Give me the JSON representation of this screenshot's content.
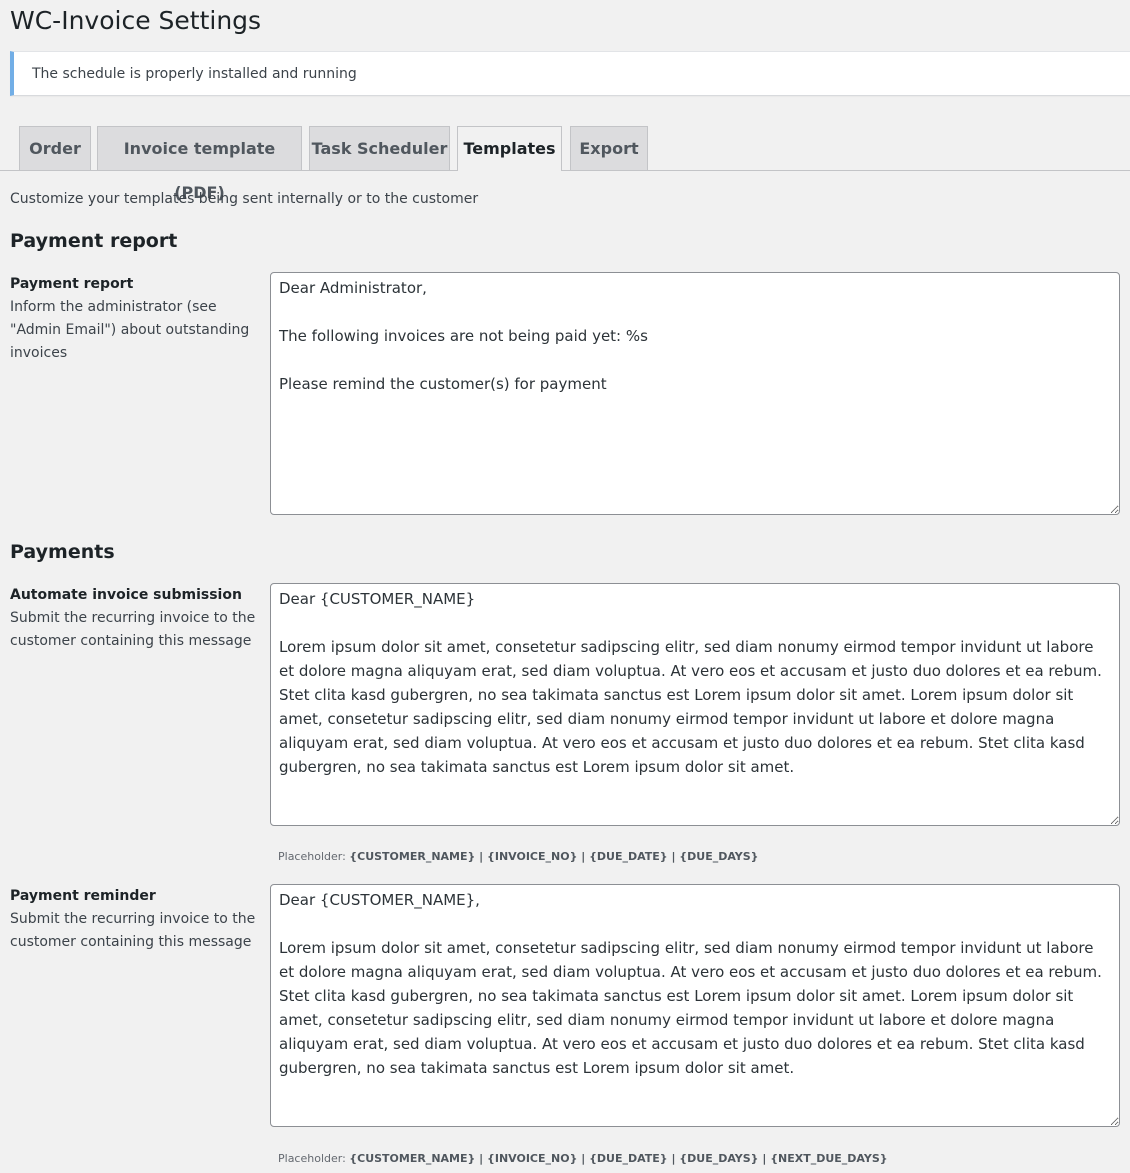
{
  "page": {
    "title": "WC-Invoice Settings"
  },
  "notice": {
    "text": "The schedule is properly installed and running"
  },
  "tabs": [
    {
      "label": "Order",
      "active": false
    },
    {
      "label": "Invoice template (PDF)",
      "active": false
    },
    {
      "label": "Task Scheduler",
      "active": false
    },
    {
      "label": "Templates",
      "active": true
    },
    {
      "label": "Export",
      "active": false
    }
  ],
  "intro": "Customize your templates being sent internally or to the customer",
  "sections": {
    "payment_report": {
      "title": "Payment report",
      "field": {
        "label": "Payment report",
        "description": "Inform the administrator (see \"Admin Email\") about outstanding invoices",
        "value": "Dear Administrator,\n\nThe following invoices are not being paid yet: %s\n\nPlease remind the customer(s) for payment"
      }
    },
    "payments": {
      "title": "Payments",
      "automate": {
        "label": "Automate invoice submission",
        "description": "Submit the recurring invoice to the customer containing this message",
        "value": "Dear {CUSTOMER_NAME}\n\nLorem ipsum dolor sit amet, consetetur sadipscing elitr, sed diam nonumy eirmod tempor invidunt ut labore et dolore magna aliquyam erat, sed diam voluptua. At vero eos et accusam et justo duo dolores et ea rebum. Stet clita kasd gubergren, no sea takimata sanctus est Lorem ipsum dolor sit amet. Lorem ipsum dolor sit amet, consetetur sadipscing elitr, sed diam nonumy eirmod tempor invidunt ut labore et dolore magna aliquyam erat, sed diam voluptua. At vero eos et accusam et justo duo dolores et ea rebum. Stet clita kasd gubergren, no sea takimata sanctus est Lorem ipsum dolor sit amet.",
        "placeholder_label": "Placeholder:",
        "placeholder_codes": "{CUSTOMER_NAME} | {INVOICE_NO} | {DUE_DATE} | {DUE_DAYS}"
      },
      "reminder": {
        "label": "Payment reminder",
        "description": "Submit the recurring invoice to the customer containing this message",
        "value": "Dear {CUSTOMER_NAME},\n\nLorem ipsum dolor sit amet, consetetur sadipscing elitr, sed diam nonumy eirmod tempor invidunt ut labore et dolore magna aliquyam erat, sed diam voluptua. At vero eos et accusam et justo duo dolores et ea rebum. Stet clita kasd gubergren, no sea takimata sanctus est Lorem ipsum dolor sit amet. Lorem ipsum dolor sit amet, consetetur sadipscing elitr, sed diam nonumy eirmod tempor invidunt ut labore et dolore magna aliquyam erat, sed diam voluptua. At vero eos et accusam et justo duo dolores et ea rebum. Stet clita kasd gubergren, no sea takimata sanctus est Lorem ipsum dolor sit amet.",
        "placeholder_label": "Placeholder:",
        "placeholder_codes": "{CUSTOMER_NAME} | {INVOICE_NO} | {DUE_DATE} | {DUE_DAYS} | {NEXT_DUE_DAYS}"
      }
    }
  }
}
